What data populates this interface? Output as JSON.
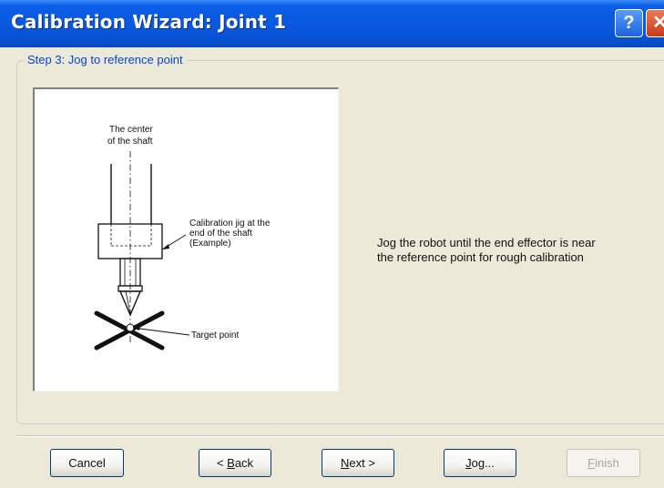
{
  "window": {
    "title": "Calibration Wizard: Joint 1",
    "help_glyph": "?",
    "close_glyph": "✕"
  },
  "step": {
    "label": "Step 3: Jog to reference point"
  },
  "figure": {
    "center_label_line1": "The center",
    "center_label_line2": "of the shaft",
    "jig_label_line1": "Calibration jig at the",
    "jig_label_line2": "end of the shaft",
    "jig_label_line3": "(Example)",
    "target_label": "Target point"
  },
  "instruction": {
    "line1": "Jog the robot until the end effector is near",
    "line2": "the reference point for rough calibration"
  },
  "buttons": {
    "cancel": {
      "prefix": "Cancel",
      "mnemonic": "",
      "suffix": ""
    },
    "back": {
      "prefix": "< ",
      "mnemonic": "B",
      "suffix": "ack"
    },
    "next": {
      "prefix": "",
      "mnemonic": "N",
      "suffix": "ext >"
    },
    "jog": {
      "prefix": "",
      "mnemonic": "J",
      "suffix": "og..."
    },
    "finish": {
      "prefix": "",
      "mnemonic": "F",
      "suffix": "inish"
    }
  }
}
